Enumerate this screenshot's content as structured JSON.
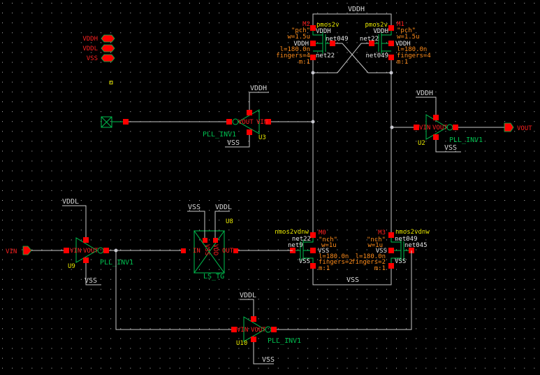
{
  "colors": {
    "background": "#000000",
    "wire": "#c8c8c8",
    "symbol": "#00c050",
    "pin": "#ff0000",
    "instance_name": "#e8e800",
    "parameter": "#ff8c1a"
  },
  "global_pins": [
    "VDDH",
    "VDDL",
    "VSS"
  ],
  "io_pins": {
    "input": "VIN",
    "output": "VOUT"
  },
  "box": {
    "top_label": "VDDH",
    "bottom_label": "VSS"
  },
  "pmos": [
    {
      "inst": "M2",
      "cell": "pmos2v",
      "model": "\"pch\"",
      "w": "w=1.5u",
      "l": "l=180.0n",
      "fingers": "fingers=4",
      "m": "m:1",
      "source": "VDDH",
      "bulk": "VDDH",
      "gate_net": "net049",
      "drain_net": "net22"
    },
    {
      "inst": "M1",
      "cell": "pmos2v",
      "model": "\"pch\"",
      "w": "w=1.5u",
      "l": "l=180.0n",
      "fingers": "fingers=4",
      "m": "m:1",
      "source": "VDDH",
      "bulk": "VDDH",
      "gate_net": "net22",
      "drain_net": "net049"
    }
  ],
  "nmos": [
    {
      "inst": "M0",
      "cell": "nmos2vdnw",
      "model": "\"nch\"",
      "w": "w=1u",
      "l": "l=180.0n",
      "fingers": "fingers=2",
      "m": "m:1",
      "drain_net": "net22",
      "gate_net": "net9",
      "bulk": "VSS",
      "source": "VSS"
    },
    {
      "inst": "M3",
      "cell": "nmos2vdnw",
      "model": "\"nch\"",
      "w": "w=1u",
      "l": "l=180.0n",
      "fingers": "fingers=2",
      "m": "m:1",
      "drain_net": "net049",
      "gate_net": "net045",
      "bulk": "VSS",
      "source": "VSS"
    }
  ],
  "inverters": [
    {
      "inst": "U3",
      "cell": "PLL_INV1",
      "vin": "VIN",
      "vout": "VOUT",
      "supply": "VDDH",
      "ground": "VSS"
    },
    {
      "inst": "U2",
      "cell": "PLL_INV1",
      "vin": "VIN",
      "vout": "VOUT",
      "supply": "VDDH",
      "ground": "VSS"
    },
    {
      "inst": "U9",
      "cell": "PLL_INV1",
      "vin": "VIN",
      "vout": "VOUT",
      "supply": "VDDL",
      "ground": "VSS"
    },
    {
      "inst": "U10",
      "cell": "PLL_INV1",
      "vin": "VIN",
      "vout": "VOUT",
      "supply": "VDDL",
      "ground": "VSS"
    }
  ],
  "level_shifter": {
    "inst": "U8",
    "cell": "LS_TG",
    "in": "IN",
    "out": "OUT",
    "vss": "VSS",
    "vdd": "VDD",
    "vss_net": "VSS",
    "vdd_net": "VDDL"
  }
}
